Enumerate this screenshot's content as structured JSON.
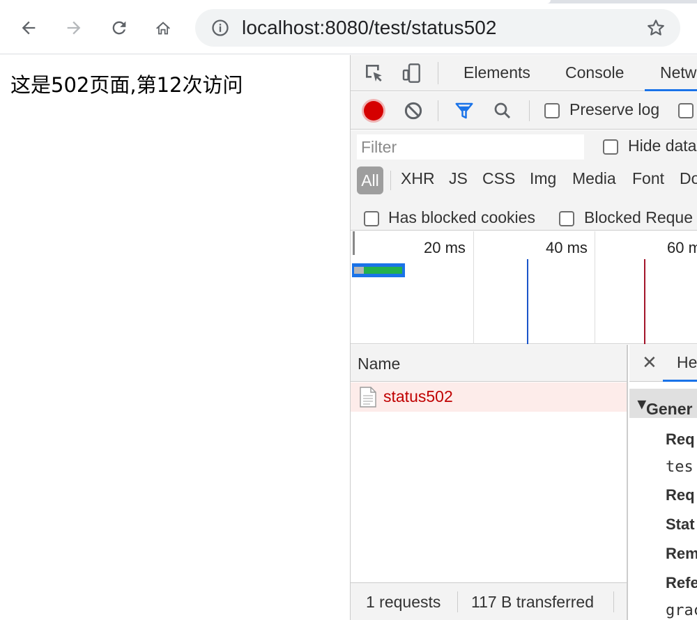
{
  "browser": {
    "url": "localhost:8080/test/status502"
  },
  "page": {
    "message": "这是502页面,第12次访问"
  },
  "devtools": {
    "tabs": [
      "Elements",
      "Console",
      "Netw"
    ],
    "toolbar": {
      "preserve_log": "Preserve log"
    },
    "filter": {
      "placeholder": "Filter",
      "hide_data": "Hide data",
      "types": [
        "All",
        "XHR",
        "JS",
        "CSS",
        "Img",
        "Media",
        "Font",
        "Do"
      ],
      "has_blocked_cookies": "Has blocked cookies",
      "blocked_requests": "Blocked Reque"
    },
    "overview": {
      "ticks": [
        "20 ms",
        "40 ms",
        "60 m"
      ]
    },
    "requests": {
      "header": "Name",
      "rows": [
        {
          "name": "status502"
        }
      ],
      "summary_count": "1 requests",
      "summary_transferred": "117 B transferred"
    },
    "details": {
      "tab": "He",
      "section": "Gener",
      "keys": [
        "Req",
        "Req",
        "Stat",
        "Rem",
        "Refe"
      ],
      "values": [
        "tes",
        "grac"
      ]
    }
  }
}
